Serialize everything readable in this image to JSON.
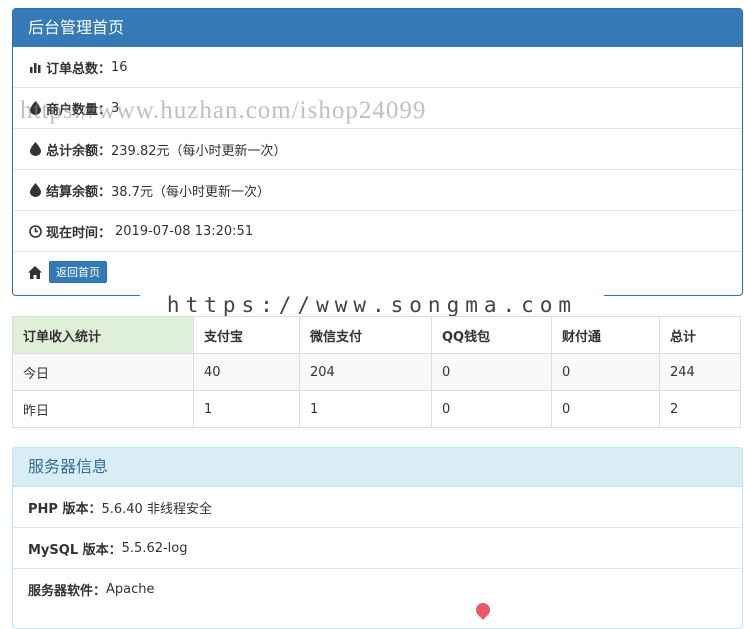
{
  "header": {
    "title": "后台管理首页"
  },
  "overview": {
    "orders_label": "订单总数：",
    "orders_value": "16",
    "merchants_label": "商户数量：",
    "merchants_value": "3",
    "total_balance_label": "总计余额：",
    "total_balance_value": "239.82元（每小时更新一次）",
    "settle_balance_label": "结算余额：",
    "settle_balance_value": "38.7元（每小时更新一次）",
    "time_label": "现在时间：",
    "time_value": "2019-07-08 13:20:51",
    "home_button": "返回首页"
  },
  "watermarks": {
    "top": "https://www.huzhan.com/ishop24099",
    "middle": "https://www.songma.com"
  },
  "income_table": {
    "headers": [
      "订单收入统计",
      "支付宝",
      "微信支付",
      "QQ钱包",
      "财付通",
      "总计"
    ],
    "rows": [
      [
        "今日",
        "40",
        "204",
        "0",
        "0",
        "244"
      ],
      [
        "昨日",
        "1",
        "1",
        "0",
        "0",
        "2"
      ]
    ]
  },
  "server": {
    "title": "服务器信息",
    "php_label": "PHP 版本：",
    "php_value": "5.6.40 非线程安全",
    "mysql_label": "MySQL 版本：",
    "mysql_value": "5.5.62-log",
    "software_label": "服务器软件：",
    "software_value": "Apache"
  },
  "colors": {
    "primary": "#337ab7",
    "info_bg": "#d9edf7",
    "success_bg": "#dff0d8"
  },
  "icons": {
    "orders": "bar-chart-icon",
    "merchants": "tint-icon",
    "balance": "tint-icon",
    "time": "clock-icon",
    "home": "home-icon"
  }
}
